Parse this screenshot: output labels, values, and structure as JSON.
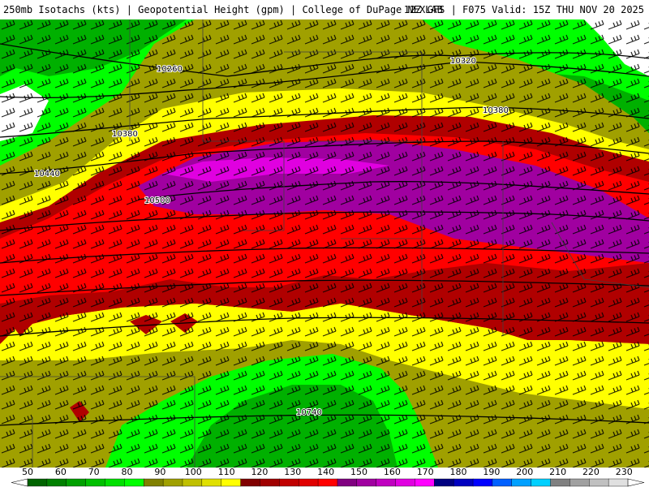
{
  "header": {
    "left": "250mb Isotachs (kts) | Geopotential Height (gpm) | College of DuPage NEXLAB",
    "right": "12Z GFS | F075 Valid: 15Z THU NOV 20 2025"
  },
  "map": {
    "contour_labels": [
      "10260",
      "10320",
      "10380",
      "10380",
      "10440",
      "10500",
      "10740"
    ]
  },
  "colorbar": {
    "labels": [
      "50",
      "60",
      "70",
      "80",
      "90",
      "100",
      "110",
      "120",
      "130",
      "140",
      "150",
      "160",
      "170",
      "180",
      "190",
      "200",
      "210",
      "220",
      "230"
    ],
    "colors": [
      "#006400",
      "#008000",
      "#00a000",
      "#00c000",
      "#00e000",
      "#00ff00",
      "#808000",
      "#a0a000",
      "#c0c000",
      "#e0e000",
      "#ffff00",
      "#800000",
      "#a00000",
      "#c00000",
      "#e00000",
      "#ff0000",
      "#800080",
      "#a000a0",
      "#c000c0",
      "#e000e0",
      "#ff00ff",
      "#000080",
      "#0000c0",
      "#0000ff",
      "#0060ff",
      "#00a0ff",
      "#00d0ff",
      "#808080",
      "#a0a0a0",
      "#c0c0c0",
      "#e0e0e0"
    ]
  },
  "colors": {
    "isotach_50_70": "#00b000",
    "isotach_70_90": "#00ff00",
    "isotach_90_100": "#a0a000",
    "isotach_100_110": "#ffff00",
    "isotach_110_130": "#b00000",
    "isotach_130_150": "#ff0000",
    "isotach_150_170": "#a000a0",
    "isotach_170_plus": "#ff00ff"
  }
}
